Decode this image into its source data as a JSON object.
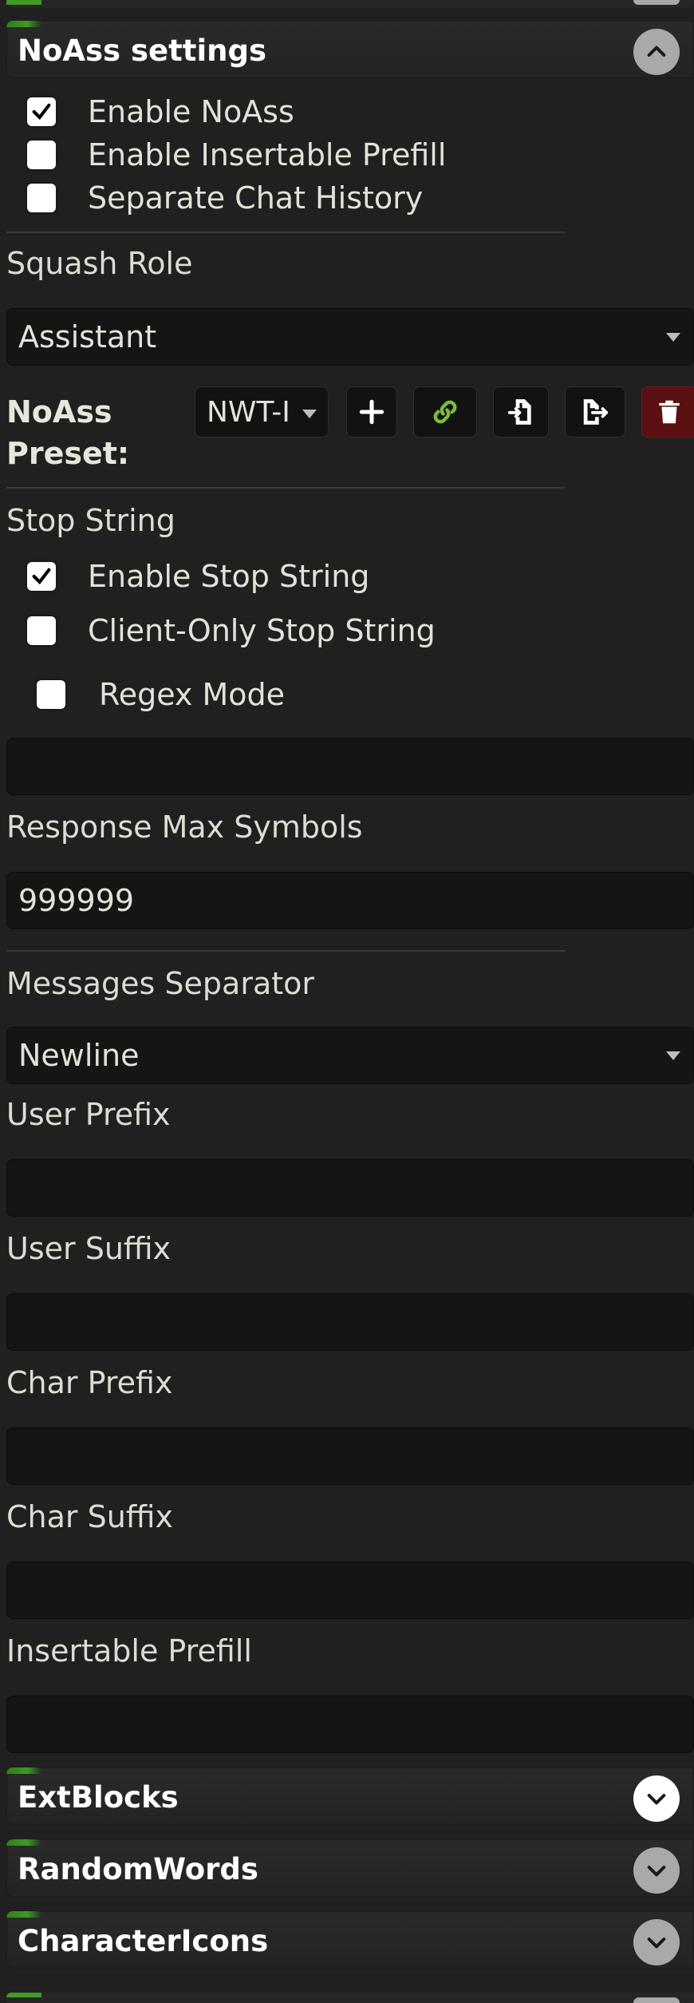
{
  "noass": {
    "title": "NoAss settings",
    "enable_noass": {
      "label": "Enable NoAss",
      "checked": true
    },
    "enable_insertable_prefill": {
      "label": "Enable Insertable Prefill",
      "checked": false
    },
    "separate_chat_history": {
      "label": "Separate Chat History",
      "checked": false
    },
    "squash_role_label": "Squash Role",
    "squash_role_value": "Assistant",
    "preset_label": "NoAss Preset:",
    "preset_value": "NWT-I",
    "stop_string_label": "Stop String",
    "enable_stop_string": {
      "label": "Enable Stop String",
      "checked": true
    },
    "client_only_stop_string": {
      "label": "Client-Only Stop String",
      "checked": false
    },
    "regex_mode": {
      "label": "Regex Mode",
      "checked": false
    },
    "stop_string_value": "",
    "response_max_symbols_label": "Response Max Symbols",
    "response_max_symbols_value": "999999",
    "messages_separator_label": "Messages Separator",
    "messages_separator_value": "Newline",
    "user_prefix_label": "User Prefix",
    "user_prefix_value": "",
    "user_suffix_label": "User Suffix",
    "user_suffix_value": "",
    "char_prefix_label": "Char Prefix",
    "char_prefix_value": "",
    "char_suffix_label": "Char Suffix",
    "char_suffix_value": "",
    "insertable_prefill_label": "Insertable Prefill",
    "insertable_prefill_value": ""
  },
  "drawers": [
    {
      "title": "ExtBlocks"
    },
    {
      "title": "RandomWords"
    },
    {
      "title": "CharacterIcons"
    }
  ],
  "colors": {
    "background": "#202020",
    "field": "#151515",
    "accent_green": "#3f9a23",
    "link_icon": "#7cbd3c",
    "delete_bg": "#5a1010"
  },
  "icons": [
    "chevron-up-icon",
    "chevron-down-icon",
    "check-icon",
    "plus-icon",
    "link-icon",
    "import-icon",
    "export-icon",
    "trash-icon"
  ]
}
